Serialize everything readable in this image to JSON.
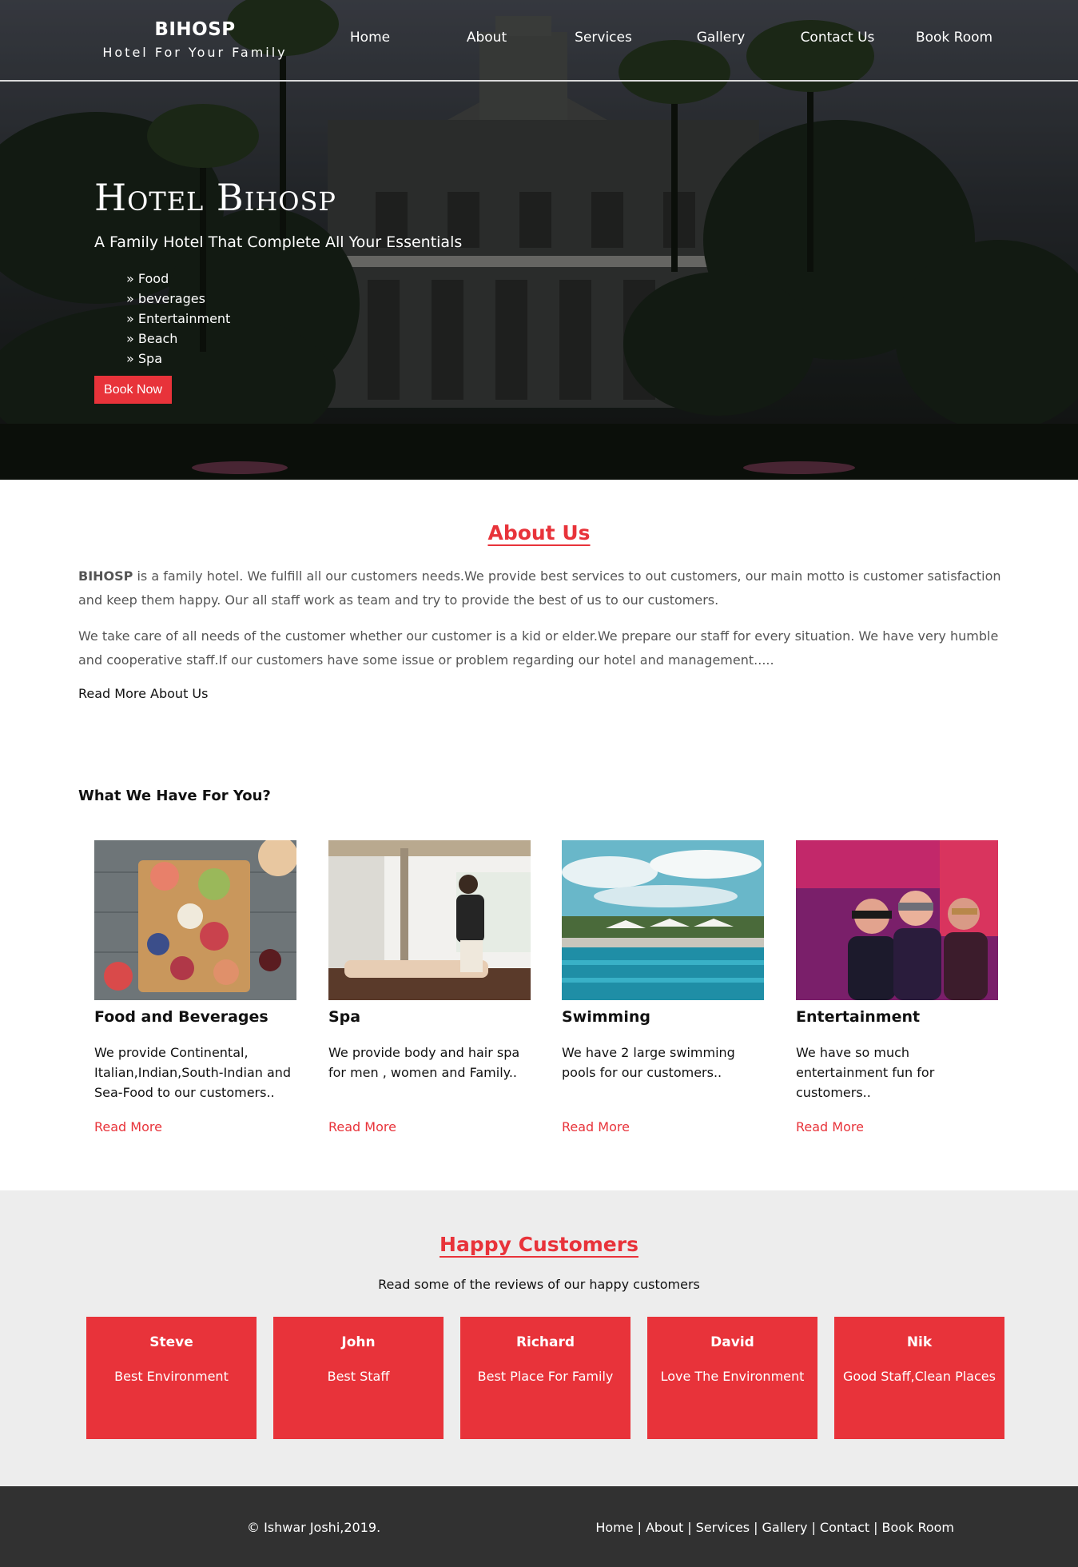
{
  "brand": {
    "name": "BIHOSP",
    "tagline": "Hotel For Your Family"
  },
  "nav": [
    "Home",
    "About",
    "Services",
    "Gallery",
    "Contact Us",
    "Book Room"
  ],
  "hero": {
    "title": "Hotel Bihosp",
    "subtitle": "A Family Hotel That Complete All Your Essentials",
    "list": [
      "» Food",
      "» beverages",
      "» Entertainment",
      "» Beach",
      "» Spa"
    ],
    "button": "Book Now"
  },
  "about": {
    "title": "About Us",
    "p1_strong": "BIHOSP",
    "p1_rest": " is a family hotel. We fulfill all our customers needs.We provide best services to out customers, our main motto is customer satisfaction and keep them happy. Our all staff work as team and try to provide the best of us to our customers.",
    "p2": "We take care of all needs of the customer whether our customer is a kid or elder.We prepare our staff for every situation. We have very humble and cooperative staff.If our customers have some issue or problem regarding our hotel and management.....",
    "read_more": "Read More About Us"
  },
  "services": {
    "title": "What We Have For You?",
    "items": [
      {
        "title": "Food and Beverages",
        "desc": "We provide Continental, Italian,Indian,South-Indian and Sea-Food to our customers..",
        "link": "Read More"
      },
      {
        "title": "Spa",
        "desc": "We provide body and hair spa for men , women and Family..",
        "link": "Read More"
      },
      {
        "title": "Swimming",
        "desc": "We have 2 large swimming pools for our customers..",
        "link": "Read More"
      },
      {
        "title": "Entertainment",
        "desc": "We have so much entertainment fun for customers..",
        "link": "Read More"
      }
    ]
  },
  "customers": {
    "title": "Happy Customers",
    "subtitle": "Read some of the reviews of our happy customers",
    "reviews": [
      {
        "name": "Steve",
        "text": "Best Environment"
      },
      {
        "name": "John",
        "text": "Best Staff"
      },
      {
        "name": "Richard",
        "text": "Best Place For Family"
      },
      {
        "name": "David",
        "text": "Love The Environment"
      },
      {
        "name": "Nik",
        "text": "Good Staff,Clean Places"
      }
    ]
  },
  "footer": {
    "copyright": "© Ishwar Joshi,2019.",
    "links": [
      "Home",
      "About",
      "Services",
      "Gallery",
      "Contact",
      "Book Room"
    ],
    "separator": "|"
  },
  "colors": {
    "accent": "#e8333a",
    "footer_bg": "#313131",
    "customers_bg": "#ededed"
  }
}
